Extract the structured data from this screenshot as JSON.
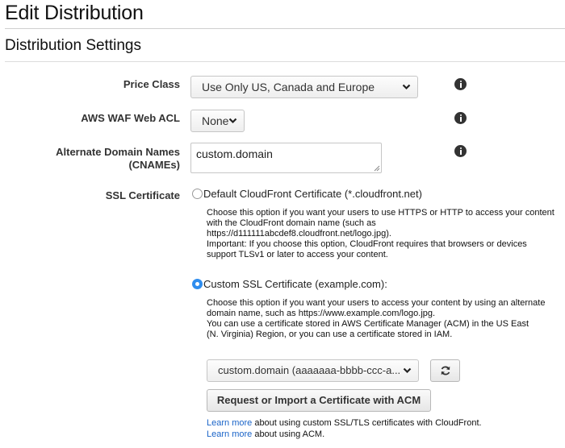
{
  "page": {
    "title": "Edit Distribution",
    "section_title": "Distribution Settings"
  },
  "form": {
    "price_class": {
      "label": "Price Class",
      "value": "Use Only US, Canada and Europe",
      "info_icon": "info-icon"
    },
    "waf": {
      "label": "AWS WAF Web ACL",
      "value": "None",
      "info_icon": "info-icon"
    },
    "cnames": {
      "label_line1": "Alternate Domain Names",
      "label_line2": "(CNAMEs)",
      "value": "custom.domain",
      "info_icon": "info-icon"
    },
    "ssl": {
      "label": "SSL Certificate",
      "selected": "custom",
      "default_option": {
        "label": "Default CloudFront Certificate (*.cloudfront.net)",
        "desc_lines": [
          "Choose this option if you want your users to use HTTPS or HTTP to access your content",
          "with the CloudFront domain name (such as",
          "https://d111111abcdef8.cloudfront.net/logo.jpg).",
          "Important: If you choose this option, CloudFront requires that browsers or devices",
          "support TLSv1 or later to access your content."
        ]
      },
      "custom_option": {
        "label": "Custom SSL Certificate (example.com):",
        "desc_lines": [
          "Choose this option if you want your users to access your content by using an alternate",
          "domain name, such as https://www.example.com/logo.jpg.",
          "You can use a certificate stored in AWS Certificate Manager (ACM) in the US East",
          "(N. Virginia) Region, or you can use a certificate stored in IAM."
        ],
        "certificate_value": "custom.domain (aaaaaaa-bbbb-ccc-a...",
        "refresh_icon": "refresh-icon",
        "request_button": "Request or Import a Certificate with ACM"
      },
      "footer": {
        "line1_link": "Learn more",
        "line1_text": " about using custom SSL/TLS certificates with CloudFront.",
        "line2_link": "Learn more",
        "line2_text": " about using ACM."
      }
    }
  }
}
